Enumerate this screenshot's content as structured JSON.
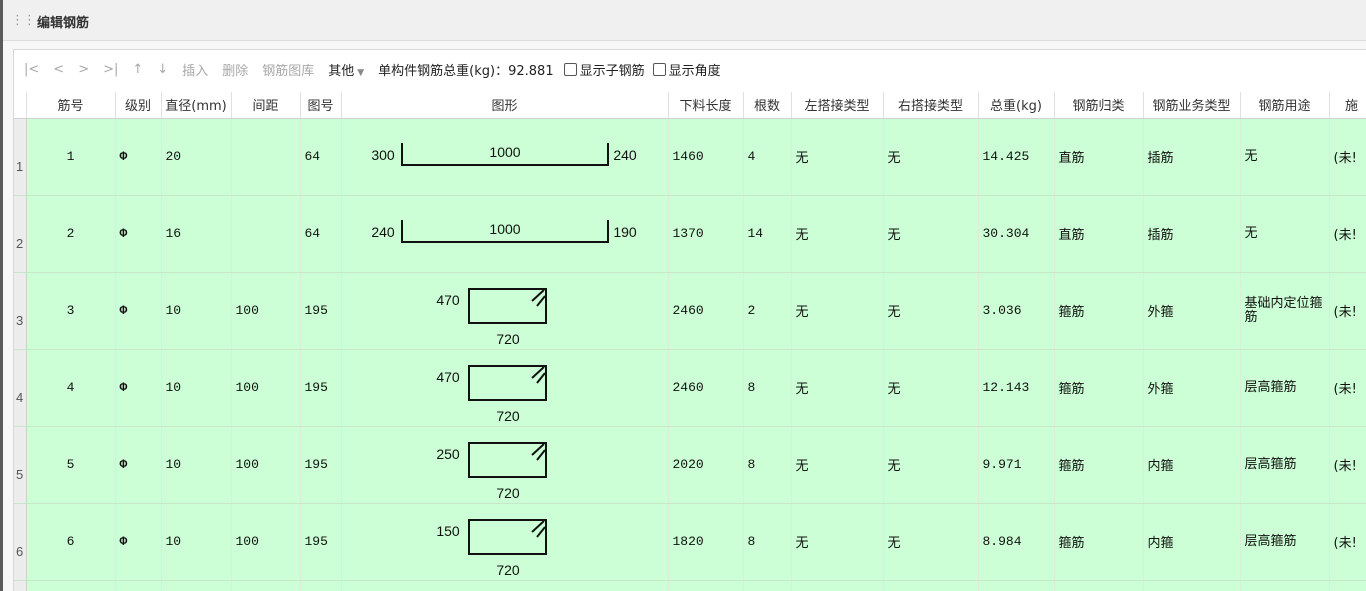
{
  "window": {
    "title": "编辑钢筋"
  },
  "toolbar": {
    "first": "|<",
    "prev": "<",
    "next": ">",
    "last": ">|",
    "up": "↑",
    "down": "↓",
    "insert": "插入",
    "delete": "删除",
    "library": "钢筋图库",
    "other": "其他",
    "total_label": "单构件钢筋总重(kg)：",
    "total_value": "92.881",
    "show_sub": "显示子钢筋",
    "show_angle": "显示角度"
  },
  "columns": {
    "bar_no": "筋号",
    "grade": "级别",
    "diameter": "直径(mm)",
    "spacing": "间距",
    "shape_no": "图号",
    "shape": "图形",
    "cut_length": "下料长度",
    "count": "根数",
    "left_lap": "左搭接类型",
    "right_lap": "右搭接类型",
    "total_weight": "总重(kg)",
    "category": "钢筋归类",
    "business_type": "钢筋业务类型",
    "usage": "钢筋用途",
    "extra": "施"
  },
  "rows": [
    {
      "idx": "1",
      "bar_no": "1",
      "grade": "Φ",
      "diameter": "20",
      "spacing": "",
      "shape_no": "64",
      "shape": {
        "kind": "straight",
        "left": "300",
        "mid": "1000",
        "right": "240"
      },
      "cut_length": "1460",
      "count": "4",
      "left_lap": "无",
      "right_lap": "无",
      "total_weight": "14.425",
      "category": "直筋",
      "business_type": "插筋",
      "usage": "无",
      "extra": "(未!"
    },
    {
      "idx": "2",
      "bar_no": "2",
      "grade": "Φ",
      "diameter": "16",
      "spacing": "",
      "shape_no": "64",
      "shape": {
        "kind": "straight",
        "left": "240",
        "mid": "1000",
        "right": "190"
      },
      "cut_length": "1370",
      "count": "14",
      "left_lap": "无",
      "right_lap": "无",
      "total_weight": "30.304",
      "category": "直筋",
      "business_type": "插筋",
      "usage": "无",
      "extra": "(未!"
    },
    {
      "idx": "3",
      "bar_no": "3",
      "grade": "Φ",
      "diameter": "10",
      "spacing": "100",
      "shape_no": "195",
      "shape": {
        "kind": "stirrup",
        "height": "470",
        "width": "720"
      },
      "cut_length": "2460",
      "count": "2",
      "left_lap": "无",
      "right_lap": "无",
      "total_weight": "3.036",
      "category": "箍筋",
      "business_type": "外箍",
      "usage": "基础内定位箍筋",
      "extra": "(未!"
    },
    {
      "idx": "4",
      "bar_no": "4",
      "grade": "Φ",
      "diameter": "10",
      "spacing": "100",
      "shape_no": "195",
      "shape": {
        "kind": "stirrup",
        "height": "470",
        "width": "720"
      },
      "cut_length": "2460",
      "count": "8",
      "left_lap": "无",
      "right_lap": "无",
      "total_weight": "12.143",
      "category": "箍筋",
      "business_type": "外箍",
      "usage": "层高箍筋",
      "extra": "(未!"
    },
    {
      "idx": "5",
      "bar_no": "5",
      "grade": "Φ",
      "diameter": "10",
      "spacing": "100",
      "shape_no": "195",
      "shape": {
        "kind": "stirrup",
        "height": "250",
        "width": "720"
      },
      "cut_length": "2020",
      "count": "8",
      "left_lap": "无",
      "right_lap": "无",
      "total_weight": "9.971",
      "category": "箍筋",
      "business_type": "内箍",
      "usage": "层高箍筋",
      "extra": "(未!"
    },
    {
      "idx": "6",
      "bar_no": "6",
      "grade": "Φ",
      "diameter": "10",
      "spacing": "100",
      "shape_no": "195",
      "shape": {
        "kind": "stirrup",
        "height": "150",
        "width": "720"
      },
      "cut_length": "1820",
      "count": "8",
      "left_lap": "无",
      "right_lap": "无",
      "total_weight": "8.984",
      "category": "箍筋",
      "business_type": "内箍",
      "usage": "层高箍筋",
      "extra": "(未!"
    }
  ]
}
